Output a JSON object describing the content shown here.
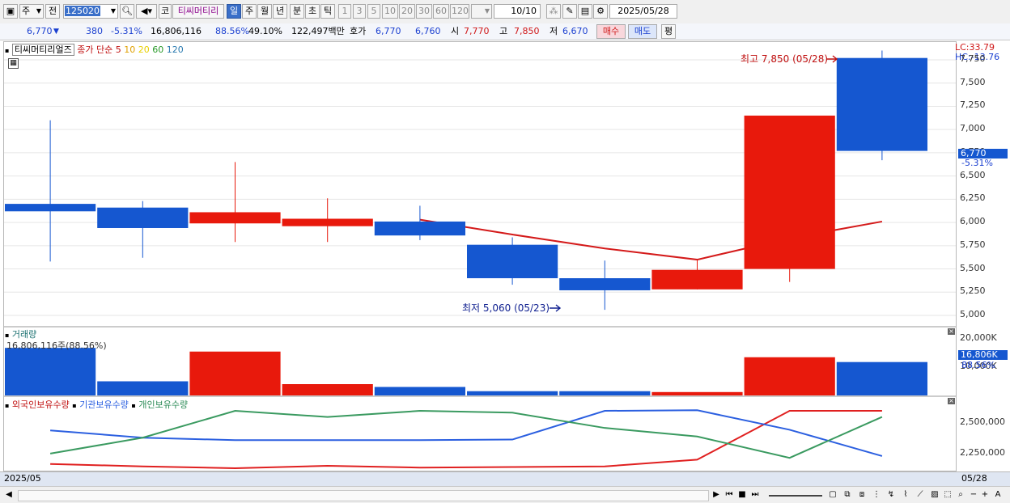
{
  "toolbar": {
    "period_value": "주",
    "jeon_label": "전",
    "code": "125020",
    "code_label": "코",
    "stock_name": "티씨머티리",
    "period_tabs": [
      "일",
      "주",
      "월",
      "년",
      "분",
      "초",
      "틱"
    ],
    "period_selected": "일",
    "interval_buttons": [
      "1",
      "3",
      "5",
      "10",
      "20",
      "30",
      "60",
      "120"
    ],
    "count": "10/10",
    "date": "2025/05/28"
  },
  "quote": {
    "price": "6,770",
    "change": "380",
    "change_pct": "-5.31%",
    "volume": "16,806,116",
    "vol_ratio": "88.56%",
    "ratio2": "49.10%",
    "amount": "122,497백만",
    "hoga_label": "호가",
    "ask": "6,770",
    "bid": "6,760",
    "open_label": "시",
    "open": "7,770",
    "high_label": "고",
    "high": "7,850",
    "low_label": "저",
    "low": "6,670",
    "buy_label": "매수",
    "sell_label": "매도",
    "avg_label": "평"
  },
  "price_panel": {
    "stock_label": "티씨머티리얼즈",
    "ma_label": "종가 단순",
    "ma_periods": [
      "5",
      "10",
      "20",
      "60",
      "120"
    ],
    "lc": "LC:33.79",
    "hc": "HC:-13.76",
    "yticks": [
      "7,750",
      "7,500",
      "7,250",
      "7,000",
      "6,750",
      "6,500",
      "6,250",
      "6,000",
      "5,750",
      "5,500",
      "5,250",
      "5,000"
    ],
    "current_price": "6,770",
    "current_pct": "-5.31%",
    "max_note": "최고 7,850 (05/28)",
    "min_note": "최저 5,060 (05/23)"
  },
  "volume_panel": {
    "title": "거래량",
    "info": "16,806,116주(88.56%)",
    "yticks": [
      "20,000K",
      "10,000K"
    ],
    "current": "16,806K",
    "current_pct": "88.56%"
  },
  "holding_panel": {
    "legend": [
      "외국인보유수량",
      "기관보유수량",
      "개인보유수량"
    ],
    "yticks": [
      "2,500,000",
      "2,250,000"
    ]
  },
  "footer": {
    "left_date": "2025/05",
    "right_date": "05/28"
  },
  "colors": {
    "up": "#e8190c",
    "down": "#1557d0",
    "ma5": "#d41a1a",
    "foreign": "#e02020",
    "inst": "#2b5fe0",
    "indiv": "#3a9a60"
  },
  "chart_data": [
    {
      "type": "candlestick",
      "ylim": [
        4850,
        7900
      ],
      "candles": [
        {
          "open": 6200,
          "high": 7100,
          "low": 5580,
          "close": 6120,
          "dir": "down"
        },
        {
          "open": 6160,
          "high": 6230,
          "low": 5620,
          "close": 5940,
          "dir": "down"
        },
        {
          "open": 5990,
          "high": 6650,
          "low": 5790,
          "close": 6110,
          "dir": "up"
        },
        {
          "open": 5960,
          "high": 6260,
          "low": 5790,
          "close": 6040,
          "dir": "up"
        },
        {
          "open": 6010,
          "high": 6180,
          "low": 5810,
          "close": 5860,
          "dir": "down"
        },
        {
          "open": 5760,
          "high": 5840,
          "low": 5330,
          "close": 5400,
          "dir": "down"
        },
        {
          "open": 5400,
          "high": 5590,
          "low": 5060,
          "close": 5270,
          "dir": "down"
        },
        {
          "open": 5280,
          "high": 5600,
          "low": 5280,
          "close": 5490,
          "dir": "up"
        },
        {
          "open": 5500,
          "high": 5610,
          "low": 5360,
          "close": 7150,
          "dir": "up"
        },
        {
          "open": 7770,
          "high": 7850,
          "low": 6670,
          "close": 6770,
          "dir": "down"
        }
      ],
      "ma5": [
        null,
        null,
        null,
        null,
        6030,
        5870,
        5720,
        5600,
        5830,
        6010
      ]
    },
    {
      "type": "bar",
      "values": [
        16806,
        5000,
        15500,
        4000,
        3000,
        1500,
        1500,
        1200,
        13500,
        11800
      ],
      "colors": [
        "down",
        "down",
        "up",
        "up",
        "down",
        "down",
        "down",
        "up",
        "up",
        "down"
      ],
      "ylim": [
        0,
        24000
      ]
    },
    {
      "type": "line",
      "ylim": [
        2130000,
        2640000
      ],
      "series": [
        {
          "name": "외국인보유수량",
          "values": [
            2165000,
            2145000,
            2130000,
            2150000,
            2135000,
            2140000,
            2145000,
            2200000,
            2600000,
            2600000
          ]
        },
        {
          "name": "기관보유수량",
          "values": [
            2440000,
            2380000,
            2360000,
            2360000,
            2360000,
            2365000,
            2600000,
            2605000,
            2445000,
            2230000
          ]
        },
        {
          "name": "개인보유수량",
          "values": [
            2250000,
            2380000,
            2600000,
            2550000,
            2600000,
            2585000,
            2460000,
            2390000,
            2215000,
            2550000
          ]
        }
      ]
    }
  ]
}
